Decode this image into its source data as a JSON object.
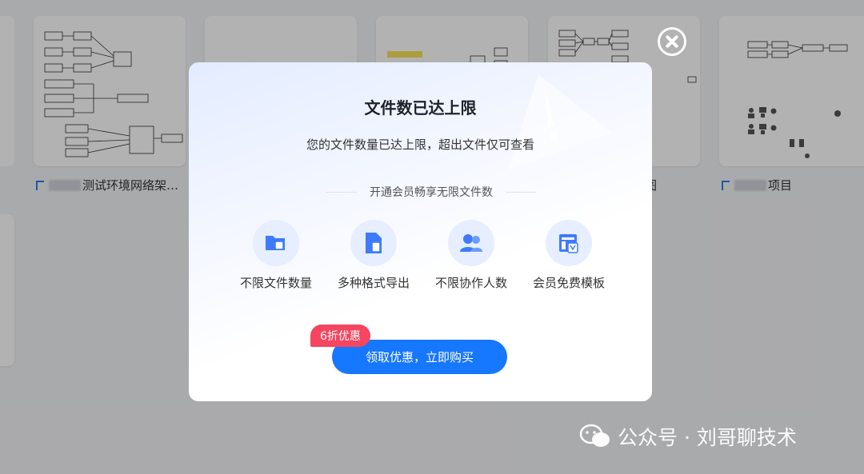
{
  "background": {
    "cards": [
      {
        "label": "测试环境网络架…",
        "has_blur": true
      },
      {
        "label": "",
        "has_blur": false
      },
      {
        "label": "",
        "has_blur": false
      },
      {
        "label": "图",
        "has_blur": false
      },
      {
        "label": "项目",
        "has_blur": true
      }
    ]
  },
  "modal": {
    "title": "文件数已达上限",
    "subtitle": "您的文件数量已达上限，超出文件仅可查看",
    "divider_text": "开通会员畅享无限文件数",
    "features": [
      {
        "label": "不限文件数量",
        "icon": "folder-icon"
      },
      {
        "label": "多种格式导出",
        "icon": "export-file-icon"
      },
      {
        "label": "不限协作人数",
        "icon": "users-icon"
      },
      {
        "label": "会员免费模板",
        "icon": "template-icon"
      }
    ],
    "cta_label": "领取优惠，立即购买",
    "discount_badge": "6折优惠"
  },
  "watermark": {
    "text": "公众号 · 刘哥聊技术"
  },
  "colors": {
    "accent": "#1677ff",
    "badge": "#f5455f"
  }
}
